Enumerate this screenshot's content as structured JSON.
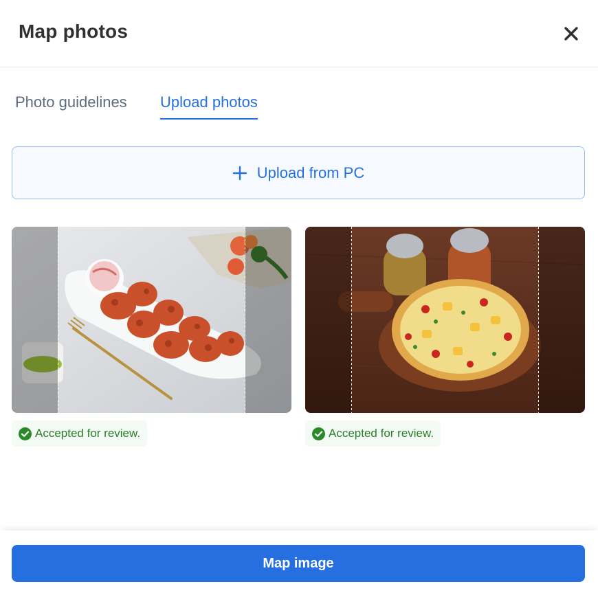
{
  "header": {
    "title": "Map photos",
    "close_icon": "close-icon"
  },
  "tabs": [
    {
      "label": "Photo guidelines",
      "active": false
    },
    {
      "label": "Upload photos",
      "active": true
    }
  ],
  "upload": {
    "label": "Upload from PC",
    "icon": "plus-icon"
  },
  "photos": [
    {
      "subject": "tandoori chicken tikka platter",
      "status": "Accepted for review.",
      "status_icon": "check-circle-icon"
    },
    {
      "subject": "paneer pizza on wooden board",
      "status": "Accepted for review.",
      "status_icon": "check-circle-icon"
    }
  ],
  "footer": {
    "primary_label": "Map image"
  },
  "colors": {
    "accent": "#256fe0",
    "success": "#2a7d2a",
    "success_bg": "#f4fbf4"
  }
}
